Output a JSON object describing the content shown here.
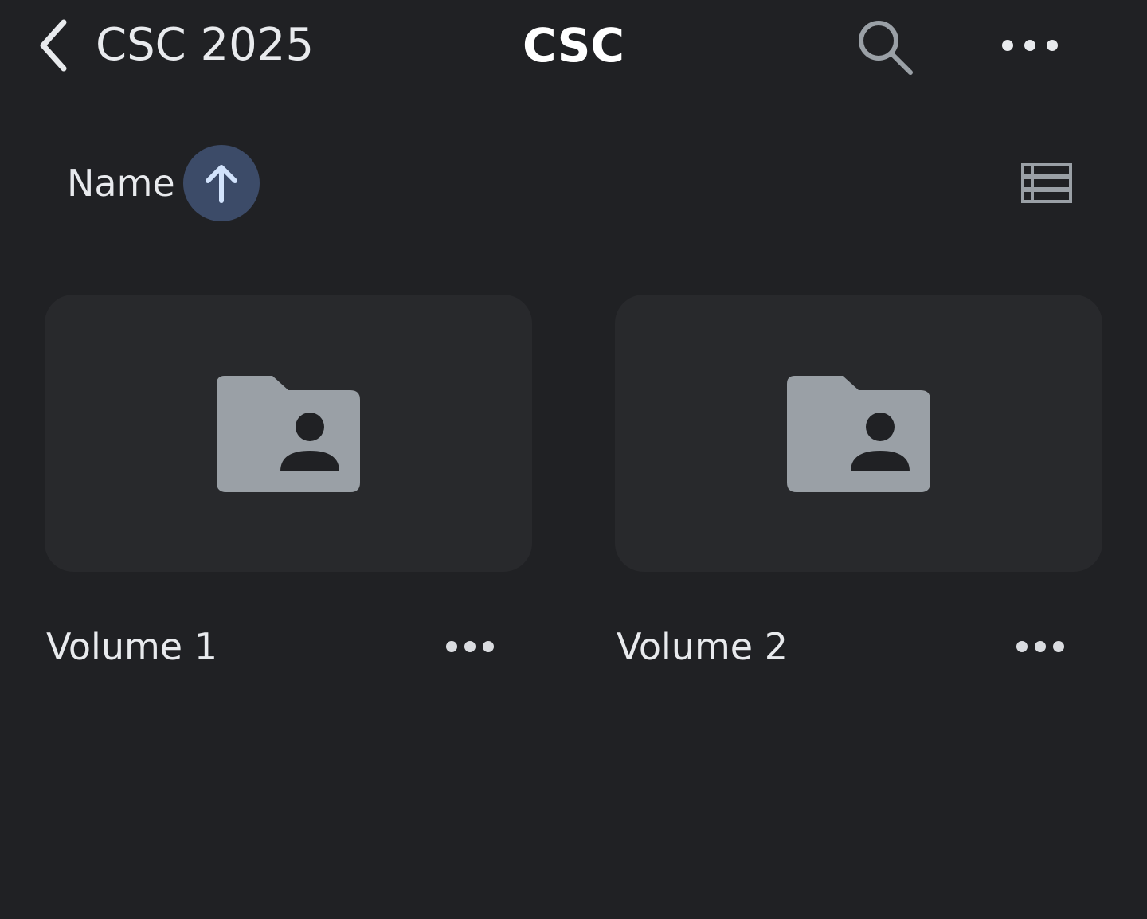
{
  "header": {
    "back_label": "CSC 2025",
    "title": "CSC",
    "back_icon": "chevron-left-icon",
    "search_icon": "search-icon",
    "more_icon": "more-horizontal-icon"
  },
  "sort": {
    "label": "Name",
    "direction": "ascending",
    "direction_icon": "arrow-up-icon",
    "view_icon": "list-view-icon"
  },
  "folders": [
    {
      "name": "Volume 1",
      "icon": "shared-folder-icon"
    },
    {
      "name": "Volume 2",
      "icon": "shared-folder-icon"
    }
  ],
  "colors": {
    "background": "#202124",
    "card": "#28292c",
    "icon_gray": "#9aa0a6",
    "accent_chip": "#3c4b68",
    "accent_arrow": "#d2e3fc",
    "text": "#e8eaed"
  }
}
